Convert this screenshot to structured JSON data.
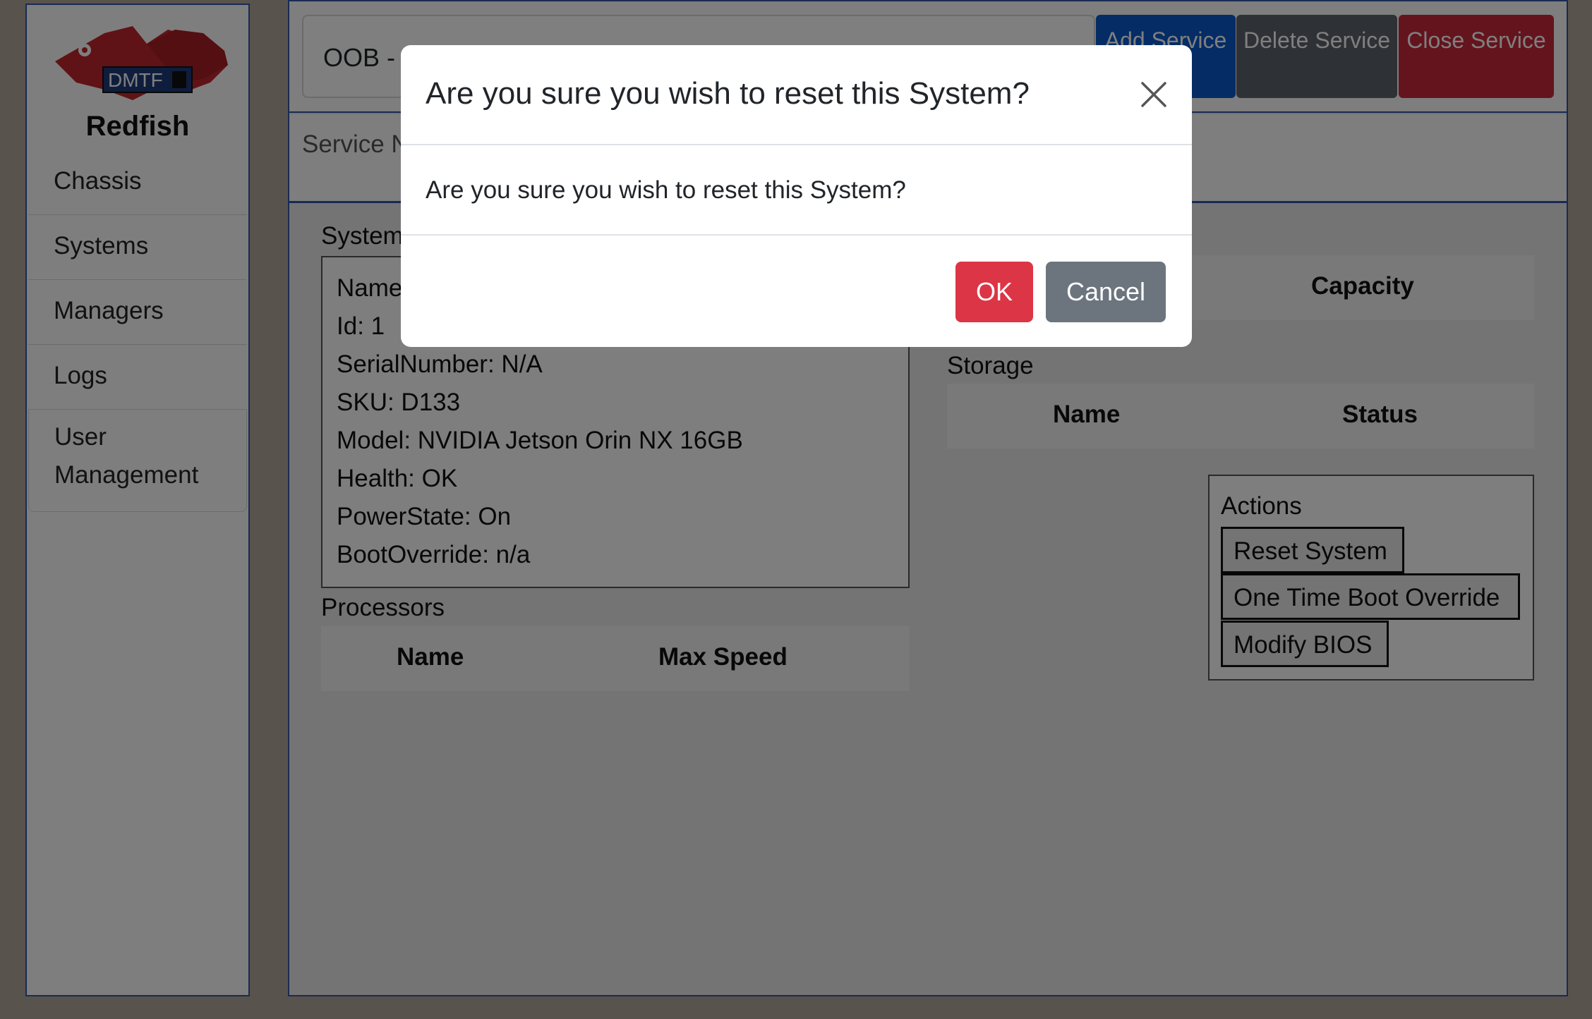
{
  "sidebar": {
    "logo_badge": "DMTF",
    "logo_text": "Redfish",
    "items": [
      {
        "label": "Chassis"
      },
      {
        "label": "Systems"
      },
      {
        "label": "Managers"
      },
      {
        "label": "Logs"
      },
      {
        "label": "User Management"
      }
    ]
  },
  "toolbar": {
    "service_value": "OOB - ",
    "add_label": "Add Service",
    "delete_label": "Delete Service",
    "close_label": "Close Service"
  },
  "service_label": "Service N",
  "system": {
    "title": "System",
    "lines": [
      "Name",
      "Id: 1",
      "SerialNumber: N/A",
      "SKU: D133",
      "Model: NVIDIA Jetson Orin NX 16GB",
      "Health: OK",
      "PowerState: On",
      "BootOverride: n/a"
    ]
  },
  "processors": {
    "title": "Processors",
    "columns": [
      "Name",
      "Max Speed"
    ]
  },
  "memory": {
    "columns": [
      "Capacity"
    ]
  },
  "storage": {
    "title": "Storage",
    "columns": [
      "Name",
      "Status"
    ]
  },
  "actions": {
    "title": "Actions",
    "buttons": [
      "Reset System",
      "One Time Boot Override",
      "Modify BIOS"
    ]
  },
  "modal": {
    "title": "Are you sure you wish to reset this System?",
    "message": "Are you sure you wish to reset this System?",
    "ok_label": "OK",
    "cancel_label": "Cancel",
    "close_icon": "close-icon"
  },
  "colors": {
    "primary": "#0a58ca",
    "secondary": "#6c757d",
    "danger": "#dc3545",
    "border_accent": "#3356a6"
  }
}
